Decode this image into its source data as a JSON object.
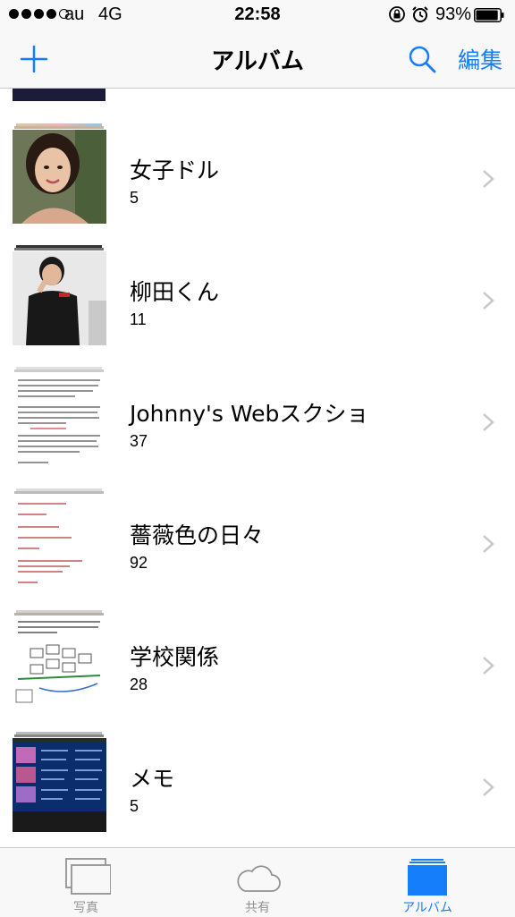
{
  "status_bar": {
    "carrier": "au",
    "network": "4G",
    "time": "22:58",
    "battery": "93%",
    "battery_level": 0.93
  },
  "nav": {
    "title": "アルバム",
    "edit_label": "編集",
    "accent_color": "#147efb"
  },
  "albums": [
    {
      "name": "女子ドル",
      "count": "5"
    },
    {
      "name": "柳田くん",
      "count": "11"
    },
    {
      "name": "Johnny's Webスクショ",
      "count": "37"
    },
    {
      "name": "薔薇色の日々",
      "count": "92"
    },
    {
      "name": "学校関係",
      "count": "28"
    },
    {
      "name": "メモ",
      "count": "5"
    }
  ],
  "tabs": [
    {
      "label": "写真",
      "active": false
    },
    {
      "label": "共有",
      "active": false
    },
    {
      "label": "アルバム",
      "active": true
    }
  ]
}
